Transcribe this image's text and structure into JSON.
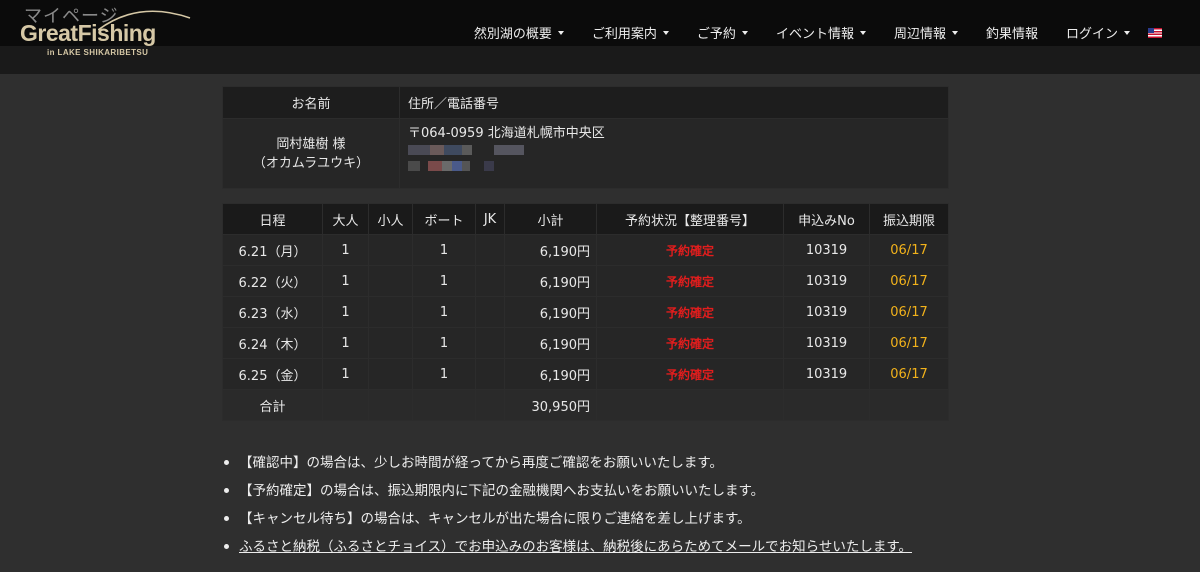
{
  "header": {
    "logo_mypage": "マイページ",
    "logo_brand": "GreatFishing",
    "logo_sub": "in LAKE SHIKARIBETSU",
    "nav": [
      {
        "label": "然別湖の概要",
        "dropdown": true
      },
      {
        "label": "ご利用案内",
        "dropdown": true
      },
      {
        "label": "ご予約",
        "dropdown": true
      },
      {
        "label": "イベント情報",
        "dropdown": true
      },
      {
        "label": "周辺情報",
        "dropdown": true
      },
      {
        "label": "釣果情報",
        "dropdown": false
      },
      {
        "label": "ログイン",
        "dropdown": true
      }
    ],
    "flag_icon": "us-flag-icon"
  },
  "customer": {
    "col_name": "お名前",
    "col_address": "住所／電話番号",
    "name": "岡村雄樹 様",
    "name_kana": "（オカムラユウキ）",
    "address_line1": "〒064-0959 北海道札幌市中央区"
  },
  "reservations": {
    "headers": [
      "日程",
      "大人",
      "小人",
      "ボート",
      "JK",
      "小計",
      "予約状況【整理番号】",
      "申込みNo",
      "振込期限"
    ],
    "rows": [
      {
        "date": "6.21（月）",
        "adult": "1",
        "child": "",
        "boat": "1",
        "jk": "",
        "subtotal": "6,190円",
        "status": "予約確定",
        "app_no": "10319",
        "deadline": "06/17"
      },
      {
        "date": "6.22（火）",
        "adult": "1",
        "child": "",
        "boat": "1",
        "jk": "",
        "subtotal": "6,190円",
        "status": "予約確定",
        "app_no": "10319",
        "deadline": "06/17"
      },
      {
        "date": "6.23（水）",
        "adult": "1",
        "child": "",
        "boat": "1",
        "jk": "",
        "subtotal": "6,190円",
        "status": "予約確定",
        "app_no": "10319",
        "deadline": "06/17"
      },
      {
        "date": "6.24（木）",
        "adult": "1",
        "child": "",
        "boat": "1",
        "jk": "",
        "subtotal": "6,190円",
        "status": "予約確定",
        "app_no": "10319",
        "deadline": "06/17"
      },
      {
        "date": "6.25（金）",
        "adult": "1",
        "child": "",
        "boat": "1",
        "jk": "",
        "subtotal": "6,190円",
        "status": "予約確定",
        "app_no": "10319",
        "deadline": "06/17"
      }
    ],
    "total_label": "合計",
    "total_amount": "30,950円"
  },
  "notes": [
    "【確認中】の場合は、少しお時間が経ってから再度ご確認をお願いいたします。",
    "【予約確定】の場合は、振込期限内に下記の金融機関へお支払いをお願いいたします。",
    "【キャンセル待ち】の場合は、キャンセルが出た場合に限りご連絡を差し上げます。",
    "ふるさと納税（ふるさとチョイス）でお申込みのお客様は、納税後にあらためてメールでお知らせいたします。"
  ],
  "colors": {
    "status_confirmed": "#e11d1d",
    "deadline": "#f2b21b",
    "logo_gold": "#d6c8a6"
  }
}
